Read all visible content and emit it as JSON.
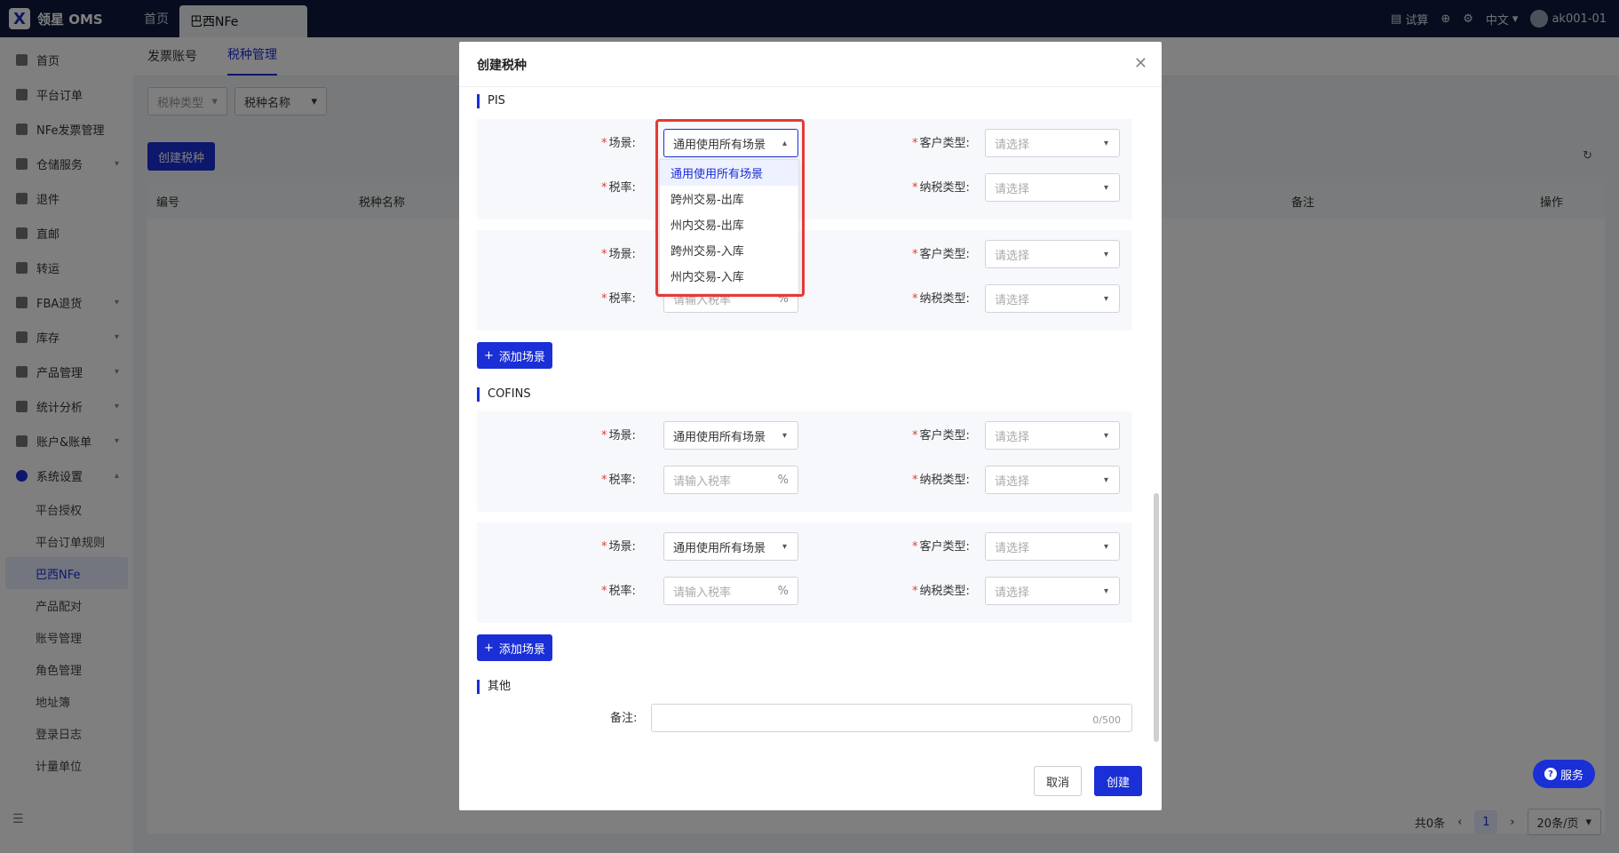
{
  "app": {
    "logo_letter": "X",
    "name": "领星 OMS"
  },
  "top_tabs": [
    {
      "label": "首页"
    },
    {
      "label": "巴西NFe"
    }
  ],
  "top_right": {
    "trial": "试算",
    "language": "中文",
    "user": "ak001-01"
  },
  "sidebar": {
    "items": [
      {
        "label": "首页"
      },
      {
        "label": "平台订单"
      },
      {
        "label": "NFe发票管理"
      },
      {
        "label": "仓储服务"
      },
      {
        "label": "退件"
      },
      {
        "label": "直邮"
      },
      {
        "label": "转运"
      },
      {
        "label": "FBA退货"
      },
      {
        "label": "库存"
      },
      {
        "label": "产品管理"
      },
      {
        "label": "统计分析"
      },
      {
        "label": "账户&账单"
      },
      {
        "label": "系统设置"
      }
    ],
    "sub_items": [
      {
        "label": "平台授权"
      },
      {
        "label": "平台订单规则"
      },
      {
        "label": "巴西NFe"
      },
      {
        "label": "产品配对"
      },
      {
        "label": "账号管理"
      },
      {
        "label": "角色管理"
      },
      {
        "label": "地址簿"
      },
      {
        "label": "登录日志"
      },
      {
        "label": "计量单位"
      }
    ]
  },
  "subtabs": [
    {
      "label": "发票账号"
    },
    {
      "label": "税种管理"
    }
  ],
  "filters": {
    "tax_type": "税种类型",
    "tax_name": "税种名称"
  },
  "create_tax_button": "创建税种",
  "table": {
    "headers": [
      "编号",
      "税种名称",
      "备注",
      "操作"
    ]
  },
  "pager": {
    "total": "共0条",
    "page": "1",
    "page_size": "20条/页"
  },
  "modal": {
    "title": "创建税种",
    "pis_title": "PIS",
    "cofins_title": "COFINS",
    "other_title": "其他",
    "scene_label": "场景:",
    "rate_label": "税率:",
    "customer_type_label": "客户类型:",
    "tax_type_label": "纳税类型:",
    "scene_value": "通用使用所有场景",
    "rate_placeholder": "请输入税率",
    "rate_suffix": "%",
    "select_placeholder": "请选择",
    "add_scene": "添加场景",
    "remark_label": "备注:",
    "remark_count": "0/500",
    "cancel": "取消",
    "create": "创建"
  },
  "dropdown": {
    "options": [
      {
        "label": "通用使用所有场景"
      },
      {
        "label": "跨州交易-出库"
      },
      {
        "label": "州内交易-出库"
      },
      {
        "label": "跨州交易-入库"
      },
      {
        "label": "州内交易-入库"
      }
    ]
  },
  "service_button": "服务",
  "colors": {
    "primary": "#1a2fd6",
    "topbar": "#0f1a3c",
    "highlight": "#e53935"
  }
}
